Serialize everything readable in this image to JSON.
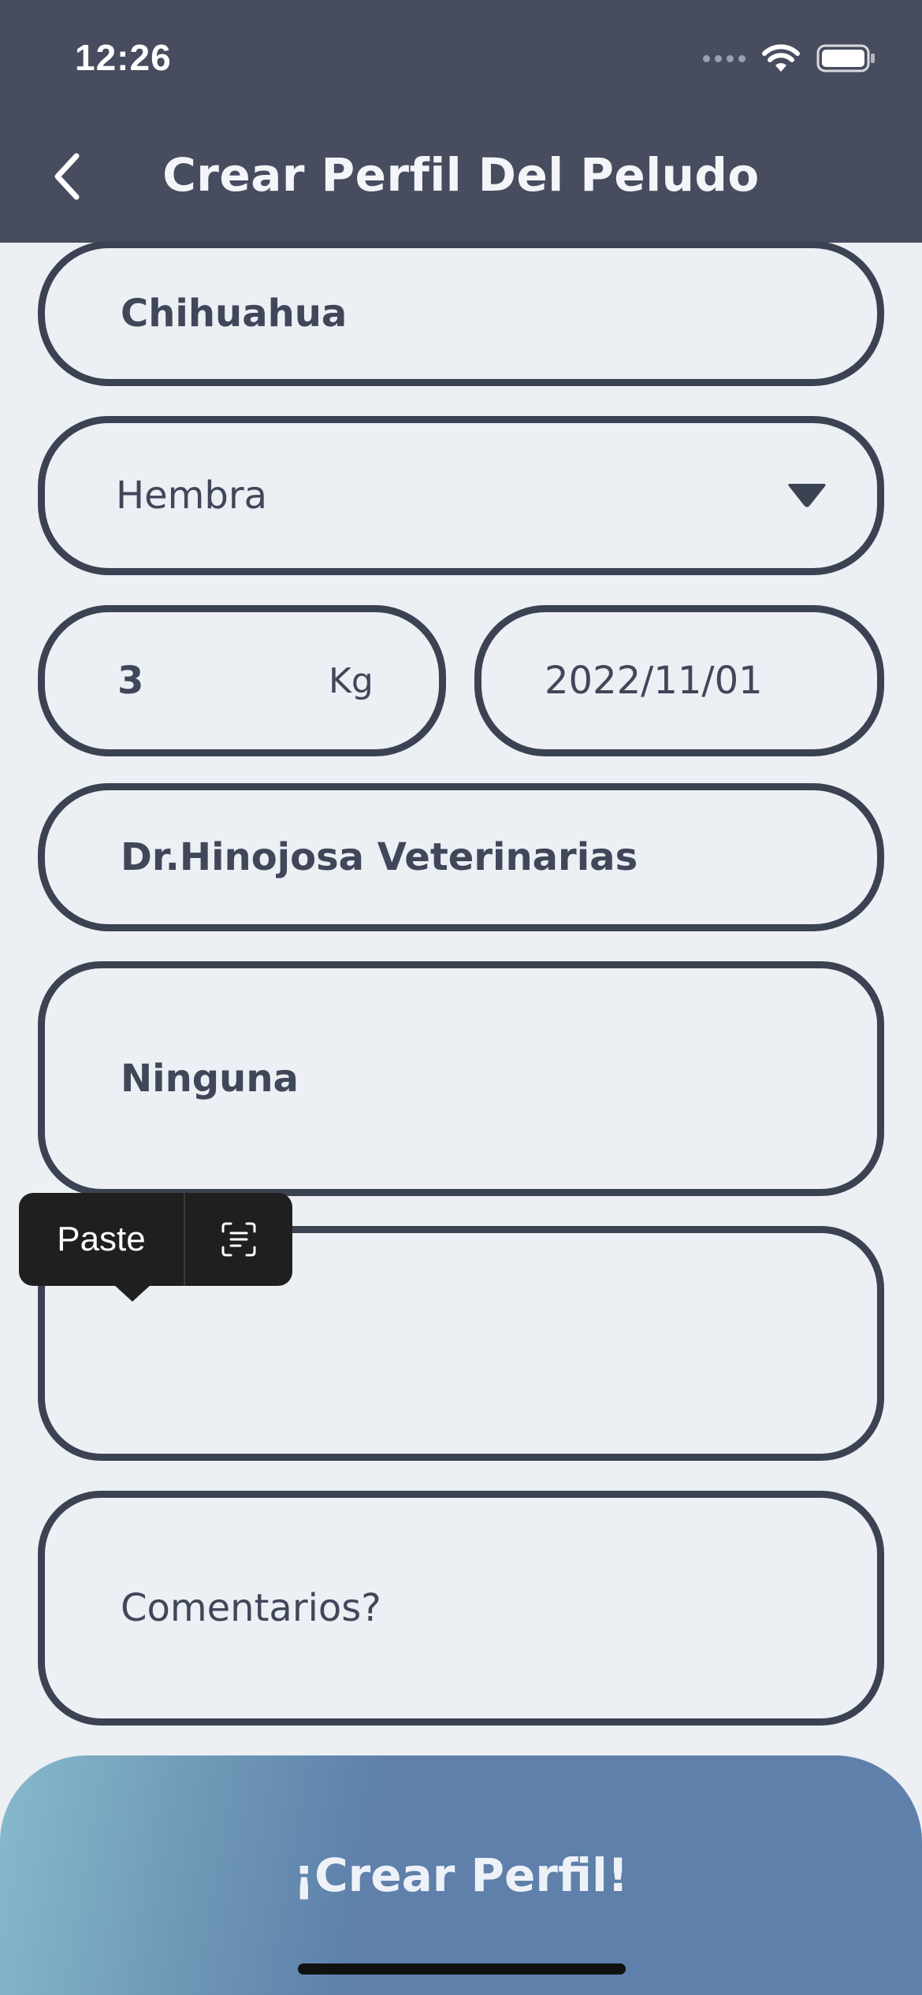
{
  "status_bar": {
    "time": "12:26"
  },
  "header": {
    "title": "Crear Perfil Del Peludo"
  },
  "form": {
    "breed": "Chihuahua",
    "sex": "Hembra",
    "weight": "3",
    "weight_unit": "Kg",
    "birth_date": "2022/11/01",
    "vet": "Dr.Hinojosa Veterinarias",
    "allergies": "Ninguna",
    "empty_field": "",
    "comments_placeholder": "Comentarios?"
  },
  "context_menu": {
    "paste_label": "Paste"
  },
  "cta": {
    "label": "¡Crear Perfil!"
  },
  "colors": {
    "header_bg": "#474d5f",
    "page_bg": "#eceff4",
    "field_border": "#3b4252",
    "cta_start": "#86bacd",
    "cta_end": "#5e80aa"
  },
  "icons": {
    "back": "chevron-left-icon",
    "dropdown": "caret-down-icon",
    "wifi": "wifi-icon",
    "battery": "battery-icon",
    "scan_text": "scan-text-icon"
  }
}
